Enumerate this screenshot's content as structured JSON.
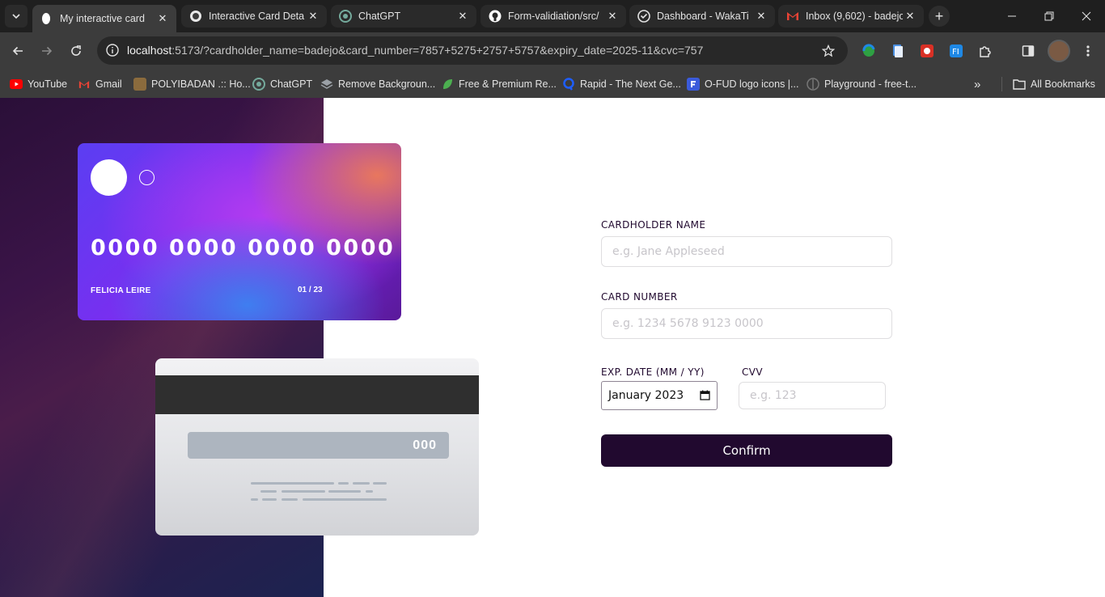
{
  "browser": {
    "tabs": [
      {
        "title": "My interactive card",
        "active": true
      },
      {
        "title": "Interactive Card Deta",
        "active": false
      },
      {
        "title": "ChatGPT",
        "active": false
      },
      {
        "title": "Form-validiation/src/",
        "active": false
      },
      {
        "title": "Dashboard - WakaTi",
        "active": false
      },
      {
        "title": "Inbox (9,602) - badejo",
        "active": false
      }
    ],
    "url_host": "localhost",
    "url_rest": ":5173/?cardholder_name=badejo&card_number=7857+5275+2757+5757&expiry_date=2025-11&cvc=757",
    "bookmarks": [
      {
        "label": "YouTube",
        "icon": "youtube-icon",
        "color": "#ff0000"
      },
      {
        "label": "Gmail",
        "icon": "gmail-icon",
        "color": "#ea4335"
      },
      {
        "label": "POLYIBADAN .:: Ho...",
        "icon": "polyibadan-icon",
        "color": "#8b6b3d"
      },
      {
        "label": "ChatGPT",
        "icon": "chatgpt-icon",
        "color": "#74aa9c"
      },
      {
        "label": "Remove Backgroun...",
        "icon": "layers-icon",
        "color": "#9aa0a6"
      },
      {
        "label": "Free & Premium Re...",
        "icon": "leaf-icon",
        "color": "#4caf50"
      },
      {
        "label": "Rapid - The Next Ge...",
        "icon": "rapid-icon",
        "color": "#1e5eff"
      },
      {
        "label": "O-FUD logo icons |...",
        "icon": "flaticon-icon",
        "color": "#3b5bdb"
      },
      {
        "label": "Playground - free-t...",
        "icon": "playground-icon",
        "color": "#777777"
      }
    ],
    "all_bookmarks": "All Bookmarks"
  },
  "card_front": {
    "number": "0000 0000 0000 0000",
    "name": "FELICIA LEIRE",
    "expiry": "01 / 23"
  },
  "card_back": {
    "cvc": "000"
  },
  "form": {
    "name_label": "CARDHOLDER NAME",
    "name_placeholder": "e.g. Jane Appleseed",
    "number_label": "CARD NUMBER",
    "number_placeholder": "e.g. 1234 5678 9123 0000",
    "exp_label": "EXP. DATE (MM / YY)",
    "exp_value": "January 2023",
    "cvv_label": "CVV",
    "cvv_placeholder": "e.g. 123",
    "confirm_label": "Confirm"
  },
  "colors": {
    "primary_dark": "#21092f",
    "input_border": "#dfdee0",
    "placeholder": "#c7c5ca"
  }
}
